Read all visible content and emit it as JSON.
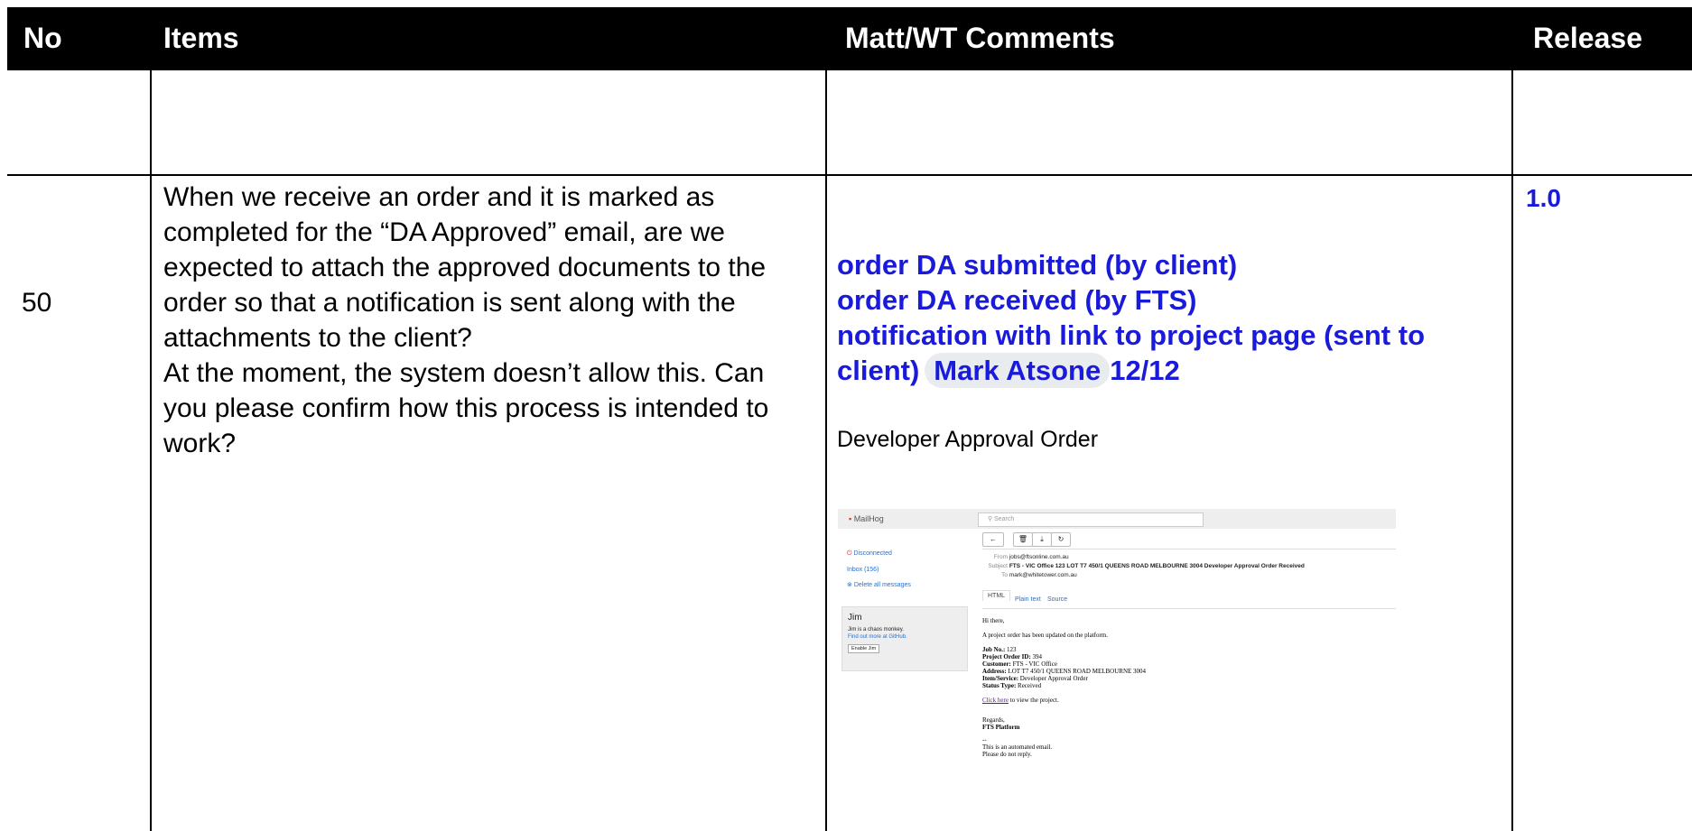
{
  "table": {
    "headers": {
      "no": "No",
      "items": "Items",
      "comments": "Matt/WT Comments",
      "release": "Release"
    },
    "row": {
      "no": "50",
      "items": [
        "When we receive an order and it is marked as",
        "completed for the “DA Approved” email, are we",
        "expected to attach the approved documents to the",
        "order so that a notification is sent along with the",
        "attachments to the client?",
        "At the moment, the system doesn’t allow this. Can",
        "you please confirm how this process is intended to",
        "work?"
      ],
      "comments_bold": [
        "order DA submitted (by client)",
        "order DA received (by FTS)",
        "notification with link to project page (sent to"
      ],
      "comments_last_line": "client)",
      "mention": "Mark Atsone",
      "mention_suffix": "12/12",
      "comments_plain": "Developer Approval Order",
      "release": "1.0"
    }
  },
  "mailhog": {
    "logo": "MailHog",
    "search_placeholder": "Search",
    "disconnected": "Disconnected",
    "inbox": "Inbox (156)",
    "delete_all": "Delete all messages",
    "jim_title": "Jim",
    "jim_desc": "Jim is a chaos monkey.",
    "jim_link": "Find out more at GitHub.",
    "jim_button": "Enable Jim",
    "from_label": "From",
    "from": "jobs@ftsonline.com.au",
    "subject_label": "Subject",
    "subject": "FTS - VIC Office 123 LOT T7 450/1 QUEENS ROAD MELBOURNE 3004 Developer Approval Order Received",
    "to_label": "To",
    "to": "mark@whitetower.com.au",
    "tabs": [
      "HTML",
      "Plain text",
      "Source"
    ],
    "body": {
      "greeting": "Hi there,",
      "intro": "A project order has been updated on the platform.",
      "fields": [
        {
          "label": "Job No.:",
          "value": "123"
        },
        {
          "label": "Project Order ID:",
          "value": "394"
        },
        {
          "label": "Customer:",
          "value": "FTS - VIC Office"
        },
        {
          "label": "Address:",
          "value": "LOT T7 450/1 QUEENS ROAD MELBOURNE 3004"
        },
        {
          "label": "Item/Service:",
          "value": "Developer Approval Order"
        },
        {
          "label": "Status Type:",
          "value": "Received"
        }
      ],
      "link": "Click here",
      "link_suffix": "to view the project.",
      "regards": "Regards,",
      "signature": "FTS Platform",
      "sep": "--",
      "footer1": "This is an automated email.",
      "footer2": "Please do not reply."
    }
  }
}
